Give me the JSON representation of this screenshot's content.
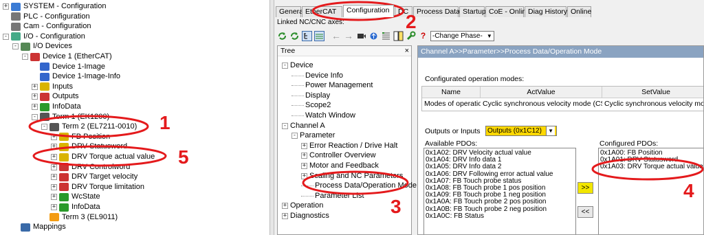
{
  "left_tree": [
    {
      "label": "SYSTEM - Configuration",
      "indent": 0,
      "exp": "+",
      "icon": "system-icon"
    },
    {
      "label": "PLC - Configuration",
      "indent": 0,
      "exp": "",
      "icon": "plc-icon"
    },
    {
      "label": "Cam - Configuration",
      "indent": 0,
      "exp": "",
      "icon": "cam-icon"
    },
    {
      "label": "I/O - Configuration",
      "indent": 0,
      "exp": "-",
      "icon": "io-config-icon"
    },
    {
      "label": "I/O Devices",
      "indent": 1,
      "exp": "-",
      "icon": "io-devices-icon"
    },
    {
      "label": "Device 1 (EtherCAT)",
      "indent": 2,
      "exp": "-",
      "icon": "ethercat-device-icon"
    },
    {
      "label": "Device 1-Image",
      "indent": 3,
      "exp": "",
      "icon": "image-icon"
    },
    {
      "label": "Device 1-Image-Info",
      "indent": 3,
      "exp": "",
      "icon": "image-icon"
    },
    {
      "label": "Inputs",
      "indent": 3,
      "exp": "+",
      "icon": "inputs-icon"
    },
    {
      "label": "Outputs",
      "indent": 3,
      "exp": "+",
      "icon": "outputs-icon"
    },
    {
      "label": "InfoData",
      "indent": 3,
      "exp": "+",
      "icon": "infodata-icon"
    },
    {
      "label": "Term 1 (EK1200)",
      "indent": 3,
      "exp": "-",
      "icon": "terminal-icon"
    },
    {
      "label": "Term 2 (EL7211-0010)",
      "indent": 4,
      "exp": "-",
      "icon": "terminal-icon"
    },
    {
      "label": "FB Position",
      "indent": 5,
      "exp": "+",
      "icon": "input-var-icon"
    },
    {
      "label": "DRV Statusword",
      "indent": 5,
      "exp": "+",
      "icon": "input-var-icon"
    },
    {
      "label": "DRV Torque actual value",
      "indent": 5,
      "exp": "+",
      "icon": "input-var-icon"
    },
    {
      "label": "DRV Controlword",
      "indent": 5,
      "exp": "+",
      "icon": "output-var-icon"
    },
    {
      "label": "DRV Target velocity",
      "indent": 5,
      "exp": "+",
      "icon": "output-var-icon"
    },
    {
      "label": "DRV Torque limitation",
      "indent": 5,
      "exp": "+",
      "icon": "output-var-icon"
    },
    {
      "label": "WcState",
      "indent": 5,
      "exp": "+",
      "icon": "wcstate-icon"
    },
    {
      "label": "InfoData",
      "indent": 5,
      "exp": "+",
      "icon": "infodata-icon"
    },
    {
      "label": "Term 3 (EL9011)",
      "indent": 4,
      "exp": "",
      "icon": "terminal-end-icon"
    },
    {
      "label": "Mappings",
      "indent": 1,
      "exp": "",
      "icon": "mappings-icon"
    }
  ],
  "tabs": [
    "General",
    "EtherCAT",
    "Configuration",
    "DC",
    "Process Data",
    "Startup",
    "CoE - Online",
    "Diag History",
    "Online"
  ],
  "active_tab": "Configuration",
  "linked_label": "Linked NC/CNC axes:",
  "change_phase": "-Change Phase-",
  "tree_panel": {
    "title": "Tree",
    "close": "×",
    "items": [
      {
        "label": "Device",
        "indent": 0,
        "exp": "-"
      },
      {
        "label": "Device Info",
        "indent": 1,
        "exp": ""
      },
      {
        "label": "Power Management",
        "indent": 1,
        "exp": ""
      },
      {
        "label": "Display",
        "indent": 1,
        "exp": ""
      },
      {
        "label": "Scope2",
        "indent": 1,
        "exp": ""
      },
      {
        "label": "Watch Window",
        "indent": 1,
        "exp": ""
      },
      {
        "label": "Channel A",
        "indent": 0,
        "exp": "-"
      },
      {
        "label": "Parameter",
        "indent": 1,
        "exp": "-"
      },
      {
        "label": "Error Reaction / Drive Halt",
        "indent": 2,
        "exp": "+"
      },
      {
        "label": "Controller Overview",
        "indent": 2,
        "exp": "+"
      },
      {
        "label": "Motor and Feedback",
        "indent": 2,
        "exp": "+"
      },
      {
        "label": "Scaling and NC Parameters",
        "indent": 2,
        "exp": "+"
      },
      {
        "label": "Process Data/Operation Mode",
        "indent": 2,
        "exp": ""
      },
      {
        "label": "Parameter List",
        "indent": 2,
        "exp": ""
      },
      {
        "label": "Operation",
        "indent": 0,
        "exp": "+"
      },
      {
        "label": "Diagnostics",
        "indent": 0,
        "exp": "+"
      }
    ]
  },
  "main_panel": {
    "header": "Channel A>>Parameter>>Process Data/Operation Mode",
    "modes_label": "Configurated operation modes:",
    "table_headers": [
      "Name",
      "ActValue",
      "SetValue"
    ],
    "table_row": [
      "Modes of operation",
      "Cyclic synchronous velocity mode (CSV)",
      "Cyclic synchronous velocity mode (CSV)"
    ],
    "outputs_label": "Outputs or Inputs",
    "outputs_value": "Outputs (0x1C12)",
    "available_label": "Available PDOs:",
    "available": [
      "0x1A02: DRV Velocity actual value",
      "0x1A04: DRV Info data 1",
      "0x1A05: DRV Info data 2",
      "0x1A06: DRV Following error actual value",
      "0x1A07: FB Touch probe status",
      "0x1A08: FB Touch probe 1 pos position",
      "0x1A09: FB Touch probe 1 neg position",
      "0x1A0A: FB Touch probe 2 pos position",
      "0x1A0B: FB Touch probe 2 neg position",
      "0x1A0C: FB Status"
    ],
    "configured_label": "Configured PDOs:",
    "configured": [
      "0x1A00: FB Position",
      "0x1A01: DRV Statusword",
      "0x1A03: DRV Torque actual value"
    ],
    "add_btn": ">>",
    "remove_btn": "<<"
  },
  "annotations": [
    "1",
    "2",
    "3",
    "4",
    "5"
  ],
  "colors": {
    "annotation": "#e41a1c",
    "header_bar": "#8aa3c1",
    "add_button": "#f2e600"
  }
}
